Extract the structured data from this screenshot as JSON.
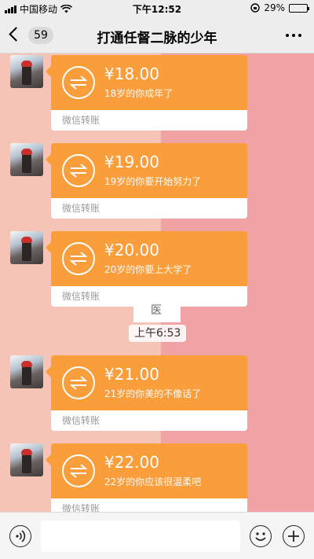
{
  "status_bar": {
    "carrier": "中国移动",
    "time": "下午12:52",
    "battery_percent": "29%",
    "battery_level": 0.29
  },
  "header": {
    "back_count": "59",
    "title": "打通任督二脉的少年"
  },
  "messages": [
    {
      "amount": "¥18.00",
      "memo": "18岁的你成年了",
      "label": "微信转账"
    },
    {
      "amount": "¥19.00",
      "memo": "19岁的你要开始努力了",
      "label": "微信转账"
    },
    {
      "amount": "¥20.00",
      "memo": "20岁的你要上大学了",
      "label": "微信转账"
    },
    {
      "amount": "¥21.00",
      "memo": "21岁的你美的不像话了",
      "label": "微信转账"
    },
    {
      "amount": "¥22.00",
      "memo": "22岁的你应该很温柔吧",
      "label": "微信转账"
    }
  ],
  "timestamp": "上午6:53",
  "image_message_glyph": "医",
  "colors": {
    "transfer_orange": "#fa9d3b",
    "bg_left": "#f6c4b7",
    "bg_right": "#f0a2a5"
  },
  "icons": [
    "signal-icon",
    "wifi-icon",
    "lock-rotation-icon",
    "battery-icon",
    "back-icon",
    "more-icon",
    "transfer-icon",
    "voice-icon",
    "emoji-icon",
    "plus-icon"
  ]
}
